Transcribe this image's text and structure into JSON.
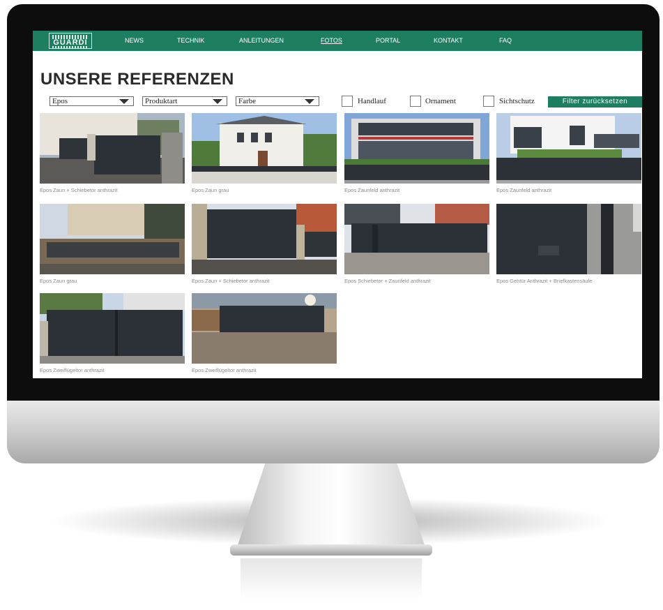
{
  "nav": {
    "logo": "GUARDI",
    "items": [
      {
        "label": "NEWS",
        "active": false
      },
      {
        "label": "TECHNIK",
        "active": false
      },
      {
        "label": "ANLEITUNGEN",
        "active": false
      },
      {
        "label": "FOTOS",
        "active": true
      },
      {
        "label": "PORTAL",
        "active": false
      },
      {
        "label": "KONTAKT",
        "active": false
      },
      {
        "label": "FAQ",
        "active": false
      }
    ]
  },
  "page": {
    "title": "UNSERE REFERENZEN"
  },
  "filters": {
    "selects": [
      "Epos",
      "Produktart",
      "Farbe"
    ],
    "checkboxes": [
      "Handlauf",
      "Ornament",
      "Sichtschutz"
    ],
    "reset_label": "Filter zurücksetzen"
  },
  "gallery": [
    {
      "caption": "Epos Zaun + Schiebetor anthrazit"
    },
    {
      "caption": "Epos Zaun grau"
    },
    {
      "caption": "Epos Zaunfeld anthrazit"
    },
    {
      "caption": "Epos Zaunfeld anthrazit"
    },
    {
      "caption": "Epos Zaun grau"
    },
    {
      "caption": "Epos Zaun + Schiebetor anthrazit"
    },
    {
      "caption": "Epos Schiebetor + Zaunfeld anthrazit"
    },
    {
      "caption": "Epos Gehtür Anthrazit + Briefkastensäule"
    },
    {
      "caption": "Epos Zweiflügeltor anthrazit"
    },
    {
      "caption": "Epos Zweiflügeltor anthrazit"
    }
  ],
  "colors": {
    "accent": "#1e7e62",
    "fence": "#2b3136"
  }
}
